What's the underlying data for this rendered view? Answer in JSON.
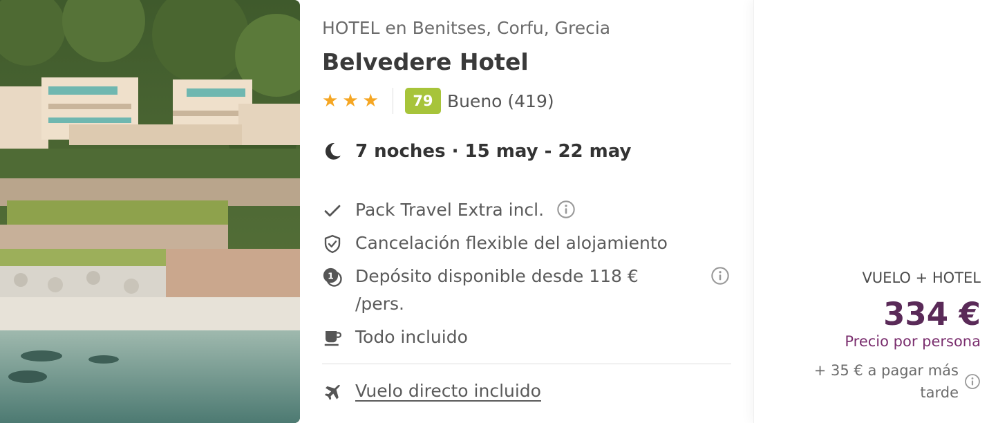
{
  "hotel": {
    "location": "HOTEL en Benitses, Corfu, Grecia",
    "name": "Belvedere Hotel",
    "stars": 3,
    "score": "79",
    "rating_text": "Bueno (419)"
  },
  "stay": {
    "dates": "7 noches · 15 may - 22 may",
    "icon": "moon-icon"
  },
  "features": [
    {
      "icon": "check-icon",
      "label": "Pack Travel Extra incl.",
      "info": true
    },
    {
      "icon": "shield-check-icon",
      "label": "Cancelación flexible del alojamiento",
      "info": false
    },
    {
      "icon": "deposit-coins-icon",
      "label": "Depósito disponible desde 118 € /pers.",
      "info": true
    },
    {
      "icon": "coffee-cup-icon",
      "label": "Todo incluido",
      "info": false
    }
  ],
  "flight": {
    "icon": "airplane-icon",
    "label": "Vuelo directo incluido"
  },
  "pricing": {
    "package_label": "VUELO + HOTEL",
    "price": "334 €",
    "per_person": "Precio por persona",
    "extra": "+ 35 € a pagar más tarde"
  },
  "colors": {
    "star": "#f5a623",
    "score_badge": "#a7c43a",
    "price": "#5a2a58"
  }
}
